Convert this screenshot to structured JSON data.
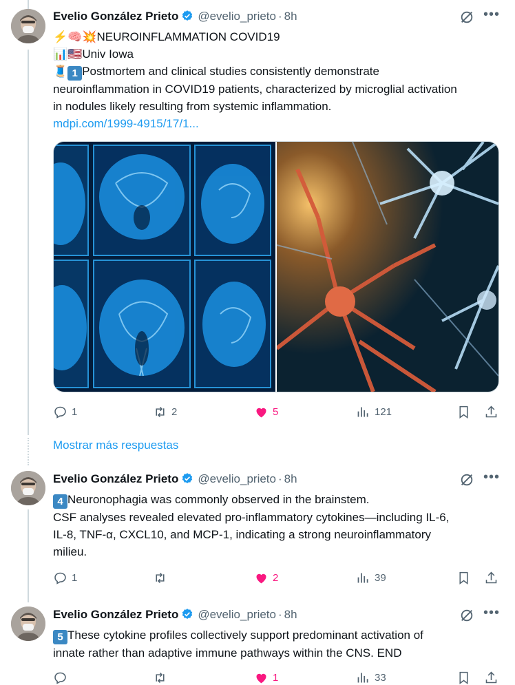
{
  "posts": [
    {
      "author": "Evelio González Prieto",
      "handle": "@evelio_prieto",
      "dot": "·",
      "time": "8h",
      "line1": "⚡🧠💥NEUROINFLAMMATION COVID19",
      "line2": "📊🇺🇸Univ Iowa",
      "line3_badge": "1",
      "line3": "Postmortem and clinical studies consistently demonstrate",
      "line4": "neuroinflammation in COVID19 patients, characterized by microglial activation",
      "line5": "in nodules likely resulting from systemic inflammation.",
      "link": "mdpi.com/1999-4915/17/1...",
      "replies": "1",
      "reposts": "2",
      "likes": "5",
      "views": "121"
    },
    {
      "author": "Evelio González Prieto",
      "handle": "@evelio_prieto",
      "dot": "·",
      "time": "8h",
      "badge": "4",
      "line1": "Neuronophagia was commonly observed in the brainstem.",
      "line2": "CSF analyses revealed elevated pro-inflammatory cytokines—including IL-6,",
      "line3": "IL-8, TNF-α, CXCL10, and MCP-1, indicating a strong neuroinflammatory",
      "line4": "milieu.",
      "replies": "1",
      "reposts": "",
      "likes": "2",
      "views": "39"
    },
    {
      "author": "Evelio González Prieto",
      "handle": "@evelio_prieto",
      "dot": "·",
      "time": "8h",
      "badge": "5",
      "line1": "These cytokine profiles collectively support predominant activation of",
      "line2": "innate rather than adaptive immune pathways within the CNS.  END",
      "likes": "1",
      "views": "33"
    }
  ],
  "show_more": "Mostrar más respuestas",
  "colors": {
    "like": "#f91880",
    "link": "#1d9bf0",
    "muted": "#536471",
    "verified": "#1d9bf0"
  },
  "icons": [
    "reply-icon",
    "repost-icon",
    "like-icon",
    "views-icon",
    "bookmark-icon",
    "share-icon",
    "grok-icon",
    "more-icon",
    "verified-icon"
  ]
}
